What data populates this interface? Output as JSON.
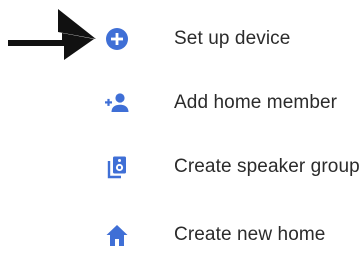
{
  "colors": {
    "accent": "#3f6fd6",
    "text": "#2b2b2b",
    "arrow": "#111111"
  },
  "menu": {
    "items": [
      {
        "label": "Set up device",
        "icon": "add-circle-icon"
      },
      {
        "label": "Add home member",
        "icon": "add-person-icon"
      },
      {
        "label": "Create speaker group",
        "icon": "speaker-group-icon"
      },
      {
        "label": "Create new home",
        "icon": "home-icon"
      }
    ]
  },
  "annotation": {
    "icon": "pointer-arrow-icon"
  }
}
